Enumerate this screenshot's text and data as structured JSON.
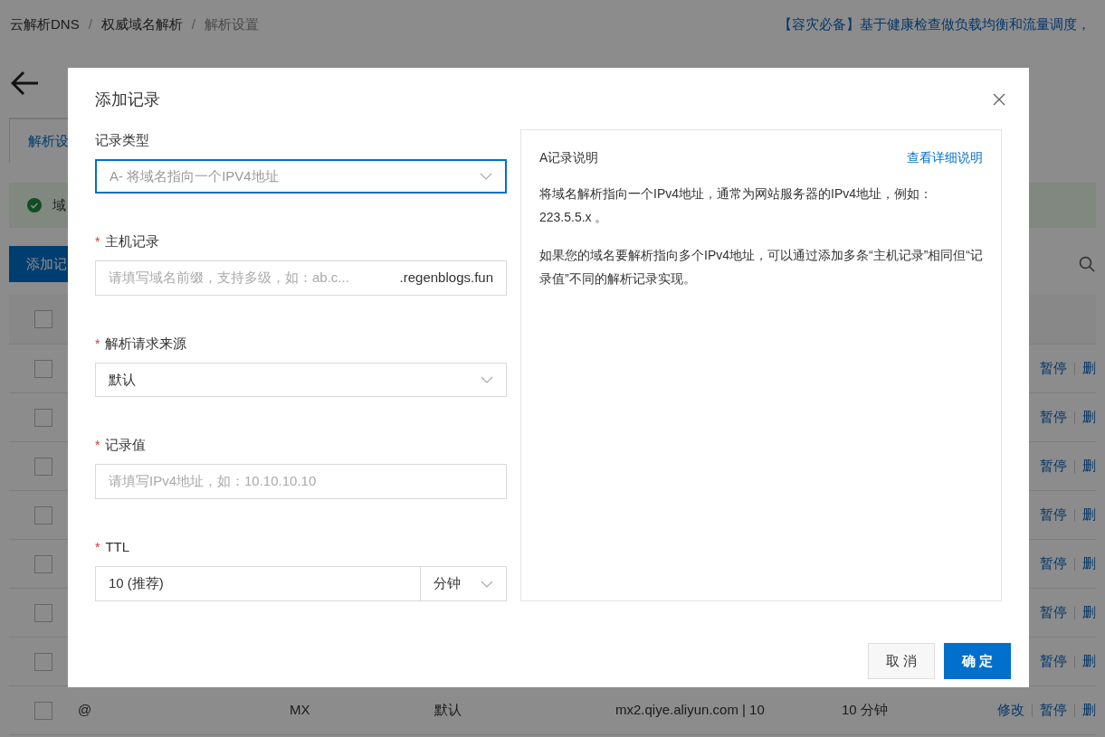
{
  "page": {
    "breadcrumb": [
      "云解析DNS",
      "权威域名解析",
      "解析设置"
    ],
    "breadcrumb_separator": "/",
    "banner": "【容灾必备】基于健康检查做负载均衡和流量调度，",
    "tab_label": "解析设",
    "alert_text": "域",
    "add_button": "添加记",
    "table": {
      "header_checked": false,
      "rows": [
        {
          "checked": false,
          "cells": [],
          "actions": [
            "暂停",
            "删"
          ]
        },
        {
          "checked": false,
          "cells": [],
          "actions": [
            "暂停",
            "删"
          ]
        },
        {
          "checked": false,
          "cells": [],
          "actions": [
            "暂停",
            "删"
          ]
        },
        {
          "checked": false,
          "cells": [],
          "actions": [
            "暂停",
            "删"
          ]
        },
        {
          "checked": false,
          "cells": [],
          "actions": [
            "暂停",
            "删"
          ]
        },
        {
          "checked": false,
          "cells": [],
          "actions": [
            "暂停",
            "删"
          ]
        },
        {
          "checked": false,
          "cells": [],
          "actions": [
            "暂停",
            "删"
          ]
        },
        {
          "checked": false,
          "cells": [
            "@",
            "MX",
            "默认",
            "mx2.qiye.aliyun.com | 10",
            "10 分钟"
          ],
          "actions": [
            "修改",
            "暂停",
            "删"
          ]
        }
      ]
    }
  },
  "dialog": {
    "title": "添加记录",
    "fields": [
      {
        "kind": "select",
        "label": "记录类型",
        "focused": true,
        "placeholder": "A- 将域名指向一个IPV4地址"
      },
      {
        "kind": "suffix",
        "label": "主机记录",
        "required_mark": "*",
        "focused": false,
        "placeholder": "请填写域名前缀，支持多级，如：ab.c...",
        "suffix": ".regenblogs.fun"
      },
      {
        "kind": "select",
        "label": "解析请求来源",
        "required_mark": "*",
        "focused": false,
        "value": "默认"
      },
      {
        "kind": "input",
        "label": "记录值",
        "required_mark": "*",
        "focused": false,
        "placeholder": "请填写IPv4地址，如：10.10.10.10"
      },
      {
        "kind": "ttl",
        "label": "TTL",
        "required_mark": "*",
        "focused": false,
        "value": "10 (推荐)",
        "unit": "分钟"
      }
    ],
    "info": {
      "title": "A记录说明",
      "link": "查看详细说明",
      "paragraphs": [
        "将域名解析指向一个IPv4地址，通常为网站服务器的IPv4地址，例如：223.5.5.x 。",
        "如果您的域名要解析指向多个IPv4地址，可以通过添加多条“主机记录”相同但“记录值”不同的解析记录实现。"
      ]
    },
    "buttons": [
      {
        "label": "取 消",
        "primary": false
      },
      {
        "label": "确 定",
        "primary": true
      }
    ]
  }
}
